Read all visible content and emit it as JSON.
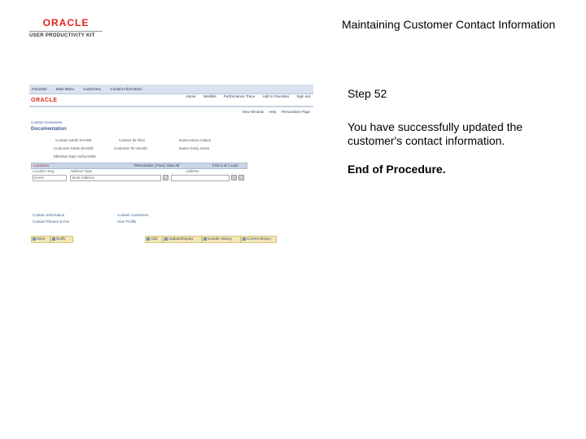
{
  "logo": {
    "brand": "ORACLE",
    "product": "USER PRODUCTIVITY KIT"
  },
  "document": {
    "title": "Maintaining Customer Contact Information",
    "step": "Step 52",
    "message": "You have successfully updated the customer's contact information.",
    "end": "End of Procedure."
  },
  "thumbnail": {
    "nav": [
      "Favorites",
      "Main Menu",
      "Customers",
      "Contact Information"
    ],
    "links": [
      "Home",
      "Worklist",
      "Performance Trace",
      "Add to Favorites",
      "Sign out"
    ],
    "brand": "ORACLE",
    "new_window": [
      "New Window",
      "Help",
      "Personalize Page"
    ],
    "breadcrumb": "Contact Customers",
    "page_heading": "Documentation",
    "fields": [
      {
        "label": "Contact SetID",
        "value": "SHARE"
      },
      {
        "label": "Contact ID",
        "value": "Files"
      },
      {
        "label": "Name",
        "value": "Moss Claiton"
      },
      {
        "label": "Customer SetID",
        "value": "SHARE"
      },
      {
        "label": "Customer ID",
        "value": "USA00"
      },
      {
        "label": "Name",
        "value": "Dorty Jones"
      },
      {
        "label": "Effective Date",
        "value": "01/01/1900"
      }
    ],
    "grid_header": {
      "title": "Locations",
      "links": "Personalize | Find | View All",
      "nav": "First 1 of 1 Last"
    },
    "grid_cols": [
      "Location Seq",
      "Address Type",
      "Address"
    ],
    "grid_row": {
      "seq": "Home",
      "type": "Work Address"
    },
    "bottom_labels": [
      "Contact Information",
      "Contact Phones & Fax",
      "Contact Customers",
      "User Profile"
    ],
    "toolbar": [
      "Save",
      "Notify",
      "Add",
      "Update/Display",
      "Include History",
      "Correct History"
    ]
  }
}
